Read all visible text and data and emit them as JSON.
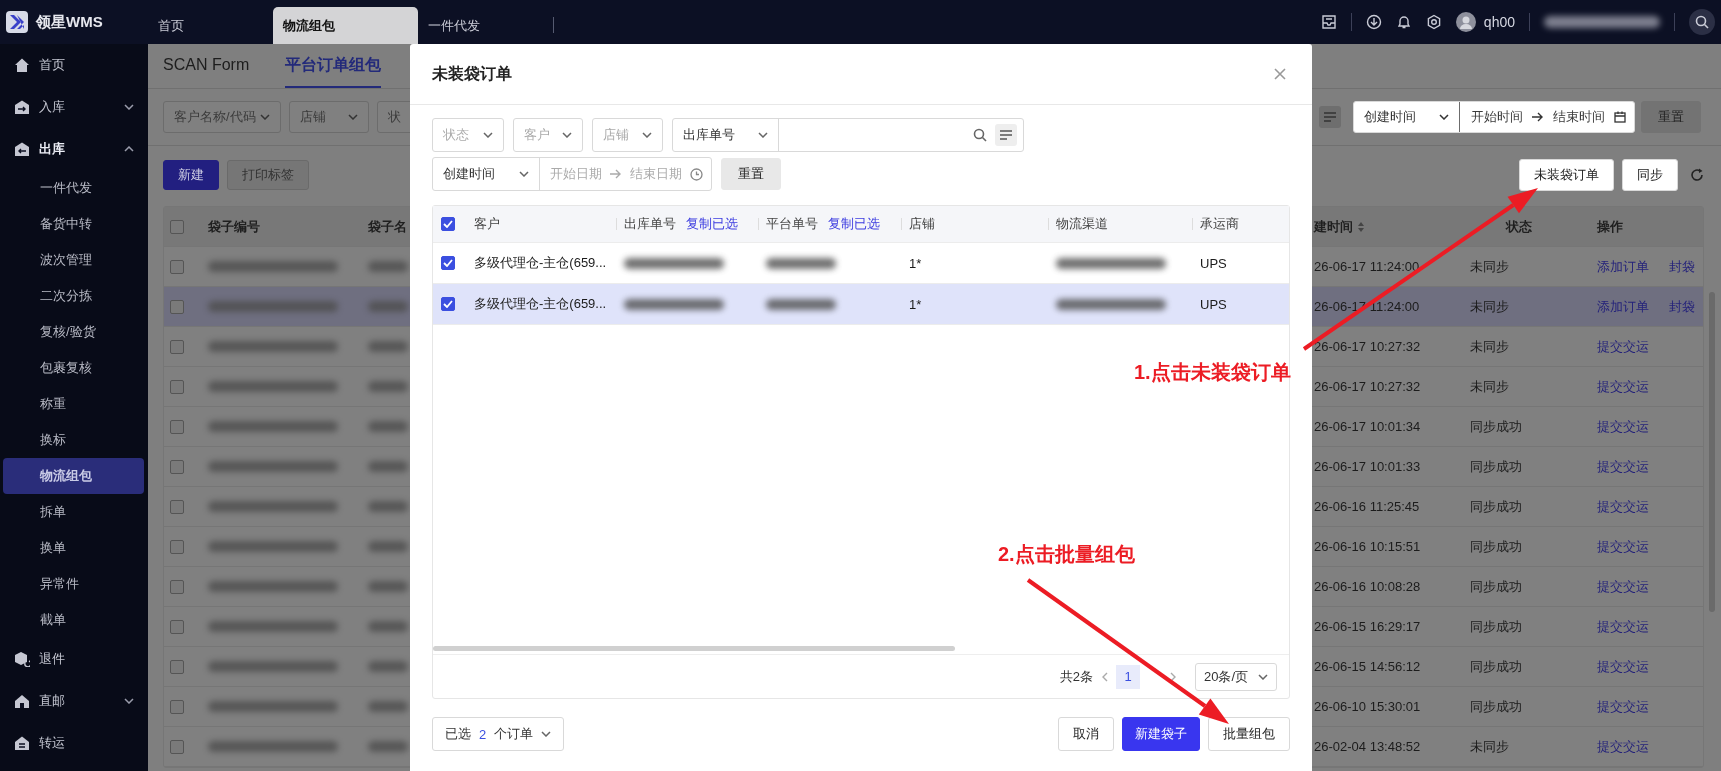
{
  "top_bar": {
    "logo": "领星WMS",
    "tabs": [
      {
        "label": "首页",
        "selected": false
      },
      {
        "label": "物流组包",
        "selected": true
      },
      {
        "label": "一件代发",
        "selected": false
      }
    ],
    "user": "qh00"
  },
  "sidebar": {
    "items": [
      {
        "label": "首页",
        "kind": "link"
      },
      {
        "label": "入库",
        "kind": "group",
        "expanded": false
      },
      {
        "label": "出库",
        "kind": "group",
        "expanded": true,
        "children": [
          {
            "label": "一件代发",
            "selected": false
          },
          {
            "label": "备货中转",
            "selected": false
          },
          {
            "label": "波次管理",
            "selected": false
          },
          {
            "label": "二次分拣",
            "selected": false
          },
          {
            "label": "复核/验货",
            "selected": false
          },
          {
            "label": "包裹复核",
            "selected": false
          },
          {
            "label": "称重",
            "selected": false
          },
          {
            "label": "换标",
            "selected": false
          },
          {
            "label": "物流组包",
            "selected": true
          },
          {
            "label": "拆单",
            "selected": false
          },
          {
            "label": "换单",
            "selected": false
          },
          {
            "label": "异常件",
            "selected": false
          },
          {
            "label": "截单",
            "selected": false
          }
        ]
      },
      {
        "label": "退件",
        "kind": "link"
      },
      {
        "label": "直邮",
        "kind": "group",
        "expanded": false
      },
      {
        "label": "转运",
        "kind": "link"
      }
    ]
  },
  "page": {
    "tabs": [
      {
        "label": "SCAN Form",
        "selected": false
      },
      {
        "label": "平台订单组包",
        "selected": true
      }
    ],
    "filters": [
      {
        "placeholder": "客户名称/代码"
      },
      {
        "placeholder": "店铺"
      },
      {
        "placeholder": "状"
      }
    ],
    "date_filter": {
      "type": "创建时间",
      "start_placeholder": "开始时间",
      "end_placeholder": "结束时间"
    },
    "reset_button": "重置",
    "left_buttons": [
      {
        "label": "新建",
        "kind": "primary"
      },
      {
        "label": "打印标签",
        "kind": "disabled"
      }
    ],
    "right_buttons": [
      {
        "label": "未装袋订单"
      },
      {
        "label": "同步"
      }
    ],
    "table": {
      "all_checked": false,
      "columns": [
        "袋子编号",
        "袋子名",
        "建时间",
        "状态",
        "操作"
      ],
      "rows": [
        {
          "checked": false,
          "highlighted": false,
          "created": "26-06-17 11:24:00",
          "sync_status": "未同步",
          "actions": [
            "添加订单",
            "封袋"
          ]
        },
        {
          "checked": false,
          "highlighted": true,
          "created": "26-06-17 11:24:00",
          "sync_status": "未同步",
          "actions": [
            "添加订单",
            "封袋"
          ]
        },
        {
          "checked": false,
          "highlighted": false,
          "created": "26-06-17 10:27:32",
          "sync_status": "未同步",
          "actions": [
            "提交交运"
          ]
        },
        {
          "checked": false,
          "highlighted": false,
          "created": "26-06-17 10:27:32",
          "sync_status": "未同步",
          "actions": [
            "提交交运"
          ]
        },
        {
          "checked": false,
          "highlighted": false,
          "created": "26-06-17 10:01:34",
          "sync_status": "同步成功",
          "actions": [
            "提交交运"
          ]
        },
        {
          "checked": false,
          "highlighted": false,
          "created": "26-06-17 10:01:33",
          "sync_status": "同步成功",
          "actions": [
            "提交交运"
          ]
        },
        {
          "checked": false,
          "highlighted": false,
          "created": "26-06-16 11:25:45",
          "sync_status": "同步成功",
          "actions": [
            "提交交运"
          ]
        },
        {
          "checked": false,
          "highlighted": false,
          "created": "26-06-16 10:15:51",
          "sync_status": "同步成功",
          "actions": [
            "提交交运"
          ]
        },
        {
          "checked": false,
          "highlighted": false,
          "created": "26-06-16 10:08:28",
          "sync_status": "同步成功",
          "actions": [
            "提交交运"
          ]
        },
        {
          "checked": false,
          "highlighted": false,
          "created": "26-06-15 16:29:17",
          "sync_status": "同步成功",
          "actions": [
            "提交交运"
          ]
        },
        {
          "checked": false,
          "highlighted": false,
          "created": "26-06-15 14:56:12",
          "sync_status": "同步成功",
          "actions": [
            "提交交运"
          ]
        },
        {
          "checked": false,
          "highlighted": false,
          "created": "26-06-10 15:30:01",
          "sync_status": "同步成功",
          "actions": [
            "提交交运"
          ]
        },
        {
          "checked": false,
          "highlighted": false,
          "created": "26-02-04 13:48:52",
          "sync_status": "未同步",
          "actions": [
            "提交交运"
          ]
        }
      ]
    }
  },
  "modal": {
    "title": "未装袋订单",
    "filters": [
      {
        "placeholder": "状态"
      },
      {
        "placeholder": "客户"
      },
      {
        "placeholder": "店铺"
      }
    ],
    "search": {
      "type": "出库单号"
    },
    "date_filter": {
      "type": "创建时间",
      "start_placeholder": "开始日期",
      "end_placeholder": "结束日期"
    },
    "reset_button": "重置",
    "table": {
      "all_checked": true,
      "columns": [
        {
          "label": "客户"
        },
        {
          "label": "出库单号",
          "link": "复制已选"
        },
        {
          "label": "平台单号",
          "link": "复制已选"
        },
        {
          "label": "店铺"
        },
        {
          "label": "物流渠道"
        },
        {
          "label": "承运商"
        }
      ],
      "rows": [
        {
          "checked": true,
          "highlighted": false,
          "customer": "多级代理仓-主仓(659...",
          "store": "1*",
          "carrier": "UPS"
        },
        {
          "checked": true,
          "highlighted": true,
          "customer": "多级代理仓-主仓(659...",
          "store": "1*",
          "carrier": "UPS"
        }
      ]
    },
    "pagination": {
      "total": "共2条",
      "pages": [
        {
          "label": "1",
          "selected": true
        }
      ],
      "page_size": "20条/页"
    },
    "selection": {
      "prefix": "已选",
      "count": "2",
      "suffix": "个订单"
    },
    "buttons": [
      {
        "label": "取消",
        "kind": "default"
      },
      {
        "label": "新建袋子",
        "kind": "primary"
      },
      {
        "label": "批量组包",
        "kind": "default"
      }
    ]
  },
  "annotations": [
    {
      "text": "1.点击未装袋订单"
    },
    {
      "text": "2.点击批量组包"
    }
  ]
}
